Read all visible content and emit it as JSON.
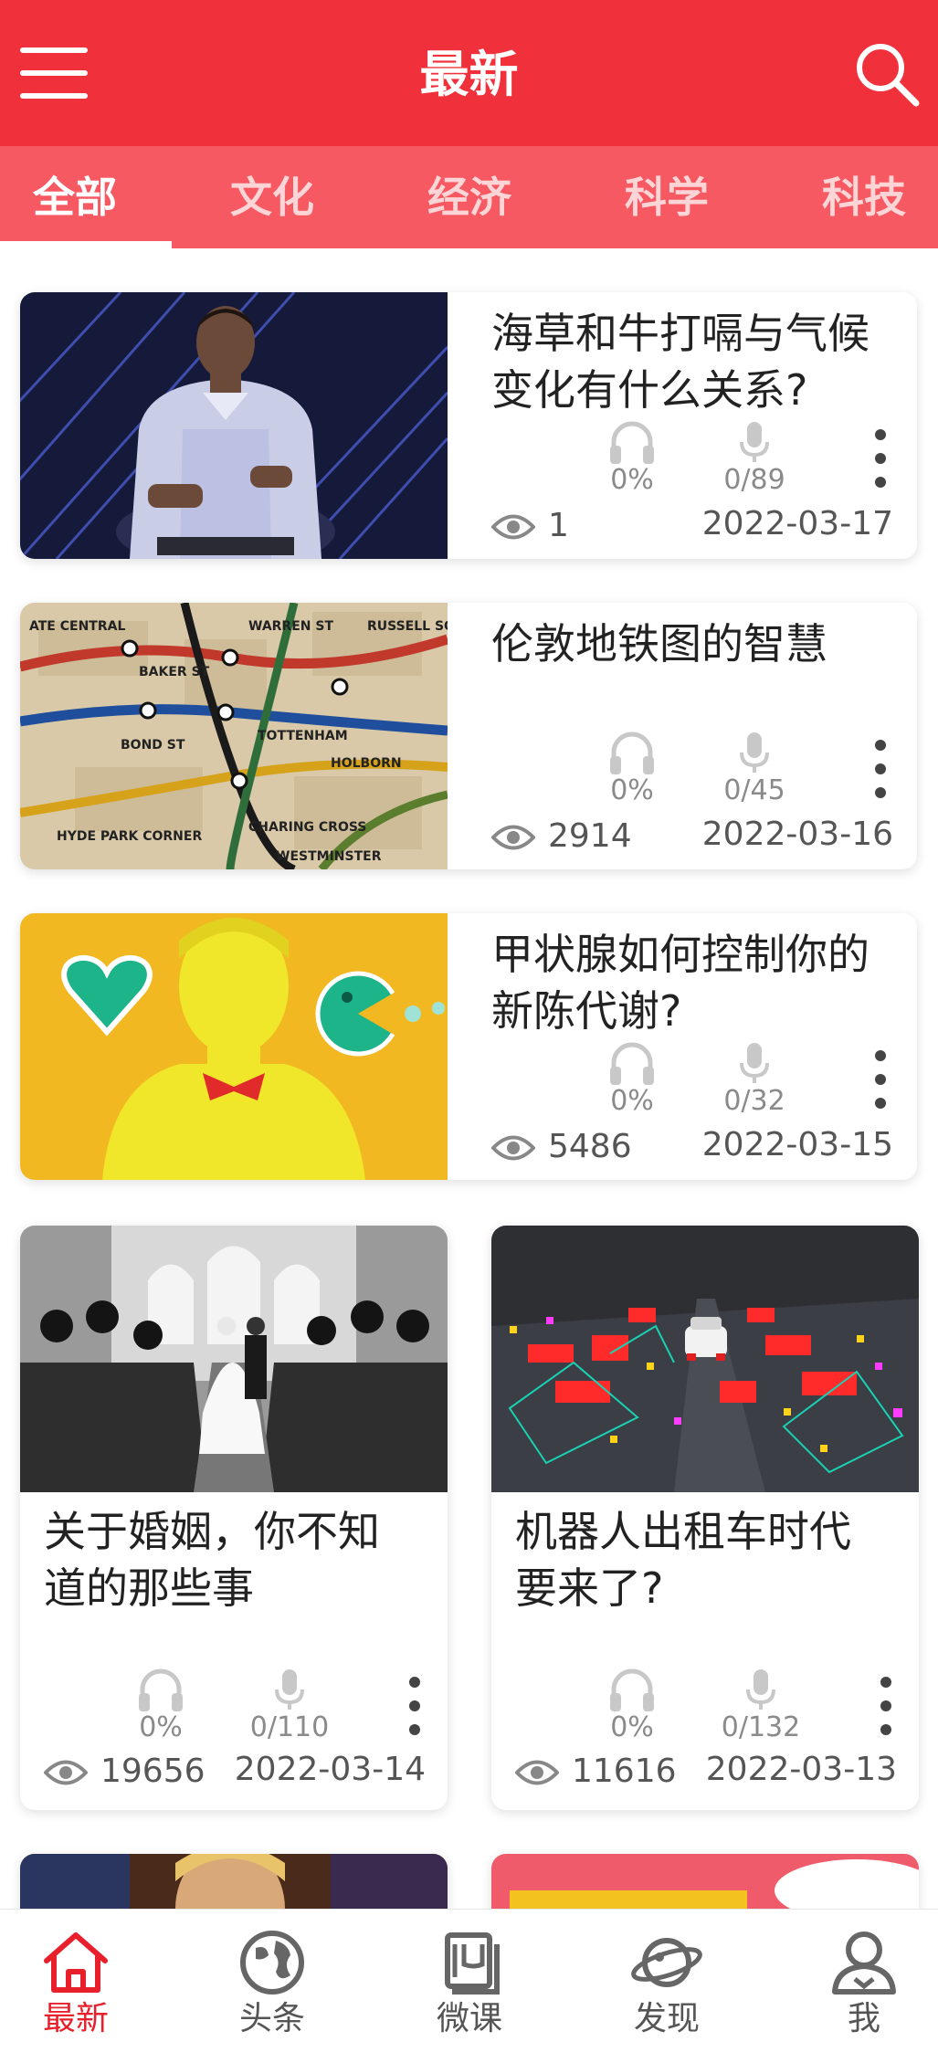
{
  "header": {
    "title": "最新"
  },
  "tabs": [
    {
      "label": "全部"
    },
    {
      "label": "文化"
    },
    {
      "label": "经济"
    },
    {
      "label": "科学"
    },
    {
      "label": "科技"
    }
  ],
  "cards": [
    {
      "title_line1": "海草和牛打嗝与气候",
      "title_line2": "变化有什么关系?",
      "listen": "0%",
      "record": "0/89",
      "views": "1",
      "date": "2022-03-17"
    },
    {
      "title_line1": "伦敦地铁图的智慧",
      "title_line2": "",
      "listen": "0%",
      "record": "0/45",
      "views": "2914",
      "date": "2022-03-16"
    },
    {
      "title_line1": "甲状腺如何控制你的",
      "title_line2": "新陈代谢?",
      "listen": "0%",
      "record": "0/32",
      "views": "5486",
      "date": "2022-03-15"
    },
    {
      "title_line1": "关于婚姻，你不知",
      "title_line2": "道的那些事",
      "listen": "0%",
      "record": "0/110",
      "views": "19656",
      "date": "2022-03-14"
    },
    {
      "title_line1": "机器人出租车时代",
      "title_line2": "要来了?",
      "listen": "0%",
      "record": "0/132",
      "views": "11616",
      "date": "2022-03-13"
    }
  ],
  "bottom_nav": [
    {
      "label": "最新",
      "icon": "home-icon"
    },
    {
      "label": "头条",
      "icon": "globe-icon"
    },
    {
      "label": "微课",
      "icon": "book-icon"
    },
    {
      "label": "发现",
      "icon": "planet-icon"
    },
    {
      "label": "我",
      "icon": "user-icon"
    }
  ],
  "colors": {
    "brand_red": "#f0313c",
    "tab_bar": "#f65962",
    "active_nav": "#e8202b"
  }
}
